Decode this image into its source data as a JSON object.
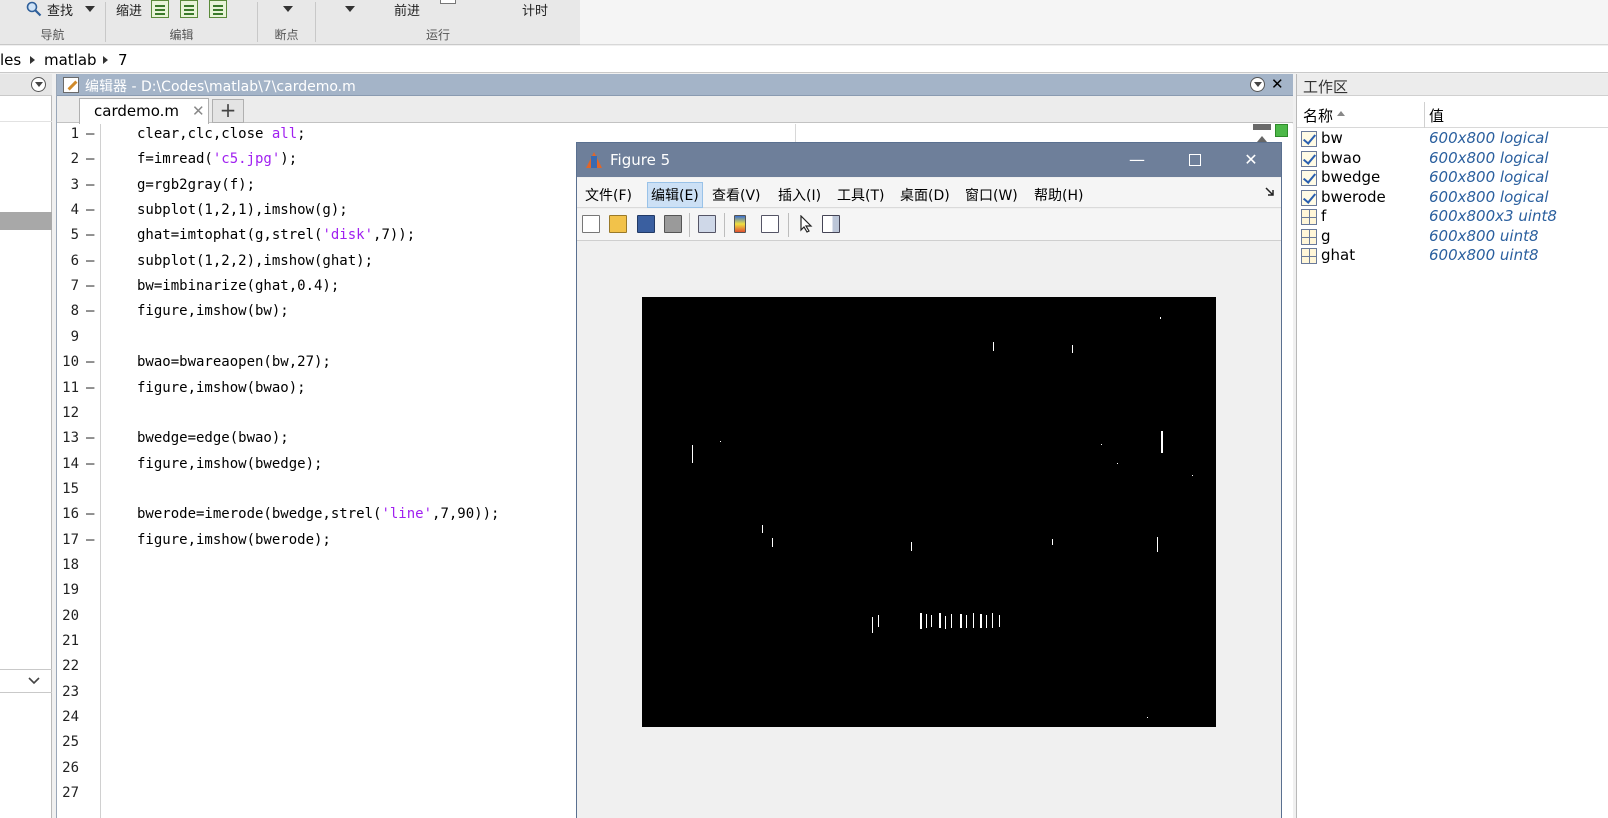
{
  "ribbon": {
    "find_label": "查找",
    "indent_label": "缩进",
    "forward_label": "前进",
    "timing_label": "计时",
    "groups": [
      "导航",
      "编辑",
      "断点",
      "运行"
    ]
  },
  "address": {
    "segments": [
      "les",
      "matlab",
      "7"
    ]
  },
  "editor": {
    "title": "编辑器 - D:\\Codes\\matlab\\7\\cardemo.m",
    "tab_label": "cardemo.m",
    "tab_add": "+",
    "close": "✕",
    "line_numbers": [
      "1",
      "2",
      "3",
      "4",
      "5",
      "6",
      "7",
      "8",
      "9",
      "10",
      "11",
      "12",
      "13",
      "14",
      "15",
      "16",
      "17",
      "18",
      "19",
      "20",
      "21",
      "22",
      "23",
      "24",
      "25",
      "26",
      "27"
    ],
    "code": [
      [
        "clear,clc,close ",
        "all",
        ";"
      ],
      [
        "f=imread(",
        "'c5.jpg'",
        ");"
      ],
      [
        "g=rgb2gray(f);",
        "",
        ""
      ],
      [
        "subplot(1,2,1),imshow(g);",
        "",
        ""
      ],
      [
        "ghat=imtophat(g,strel(",
        "'disk'",
        ",7));"
      ],
      [
        "subplot(1,2,2),imshow(ghat);",
        "",
        ""
      ],
      [
        "bw=imbinarize(ghat,0.4);",
        "",
        ""
      ],
      [
        "figure,imshow(bw);",
        "",
        ""
      ],
      [
        "",
        "",
        ""
      ],
      [
        "bwao=bwareaopen(bw,27);",
        "",
        ""
      ],
      [
        "figure,imshow(bwao);",
        "",
        ""
      ],
      [
        "",
        "",
        ""
      ],
      [
        "bwedge=edge(bwao);",
        "",
        ""
      ],
      [
        "figure,imshow(bwedge);",
        "",
        ""
      ],
      [
        "",
        "",
        ""
      ],
      [
        "bwerode=imerode(bwedge,strel(",
        "'line'",
        ",7,90));"
      ],
      [
        "figure,imshow(bwerode);",
        "",
        ""
      ]
    ]
  },
  "workspace": {
    "title": "工作区",
    "col_name": "名称",
    "col_value": "值",
    "vars": [
      {
        "name": "bw",
        "value": "600x800 logical",
        "type": "logical"
      },
      {
        "name": "bwao",
        "value": "600x800 logical",
        "type": "logical"
      },
      {
        "name": "bwedge",
        "value": "600x800 logical",
        "type": "logical"
      },
      {
        "name": "bwerode",
        "value": "600x800 logical",
        "type": "logical"
      },
      {
        "name": "f",
        "value": "600x800x3 uint8",
        "type": "array"
      },
      {
        "name": "g",
        "value": "600x800 uint8",
        "type": "array"
      },
      {
        "name": "ghat",
        "value": "600x800 uint8",
        "type": "array"
      }
    ]
  },
  "figure": {
    "title": "Figure 5",
    "minimize": "—",
    "close": "✕",
    "menu": [
      "文件(F)",
      "编辑(E)",
      "查看(V)",
      "插入(I)",
      "工具(T)",
      "桌面(D)",
      "窗口(W)",
      "帮助(H)"
    ],
    "menu_highlighted": "编辑(E)",
    "toolbar_icons": [
      "new-figure-icon",
      "open-file-icon",
      "save-icon",
      "print-icon",
      "link-icon",
      "colorbar-icon",
      "legend-icon",
      "pointer-icon",
      "property-editor-icon"
    ]
  },
  "colors": {
    "editor_title_bg": "#a4b4c8",
    "figure_title_bg": "#6e7f9a",
    "string_color": "#a020f0",
    "workspace_value_color": "#2a5f9e"
  }
}
